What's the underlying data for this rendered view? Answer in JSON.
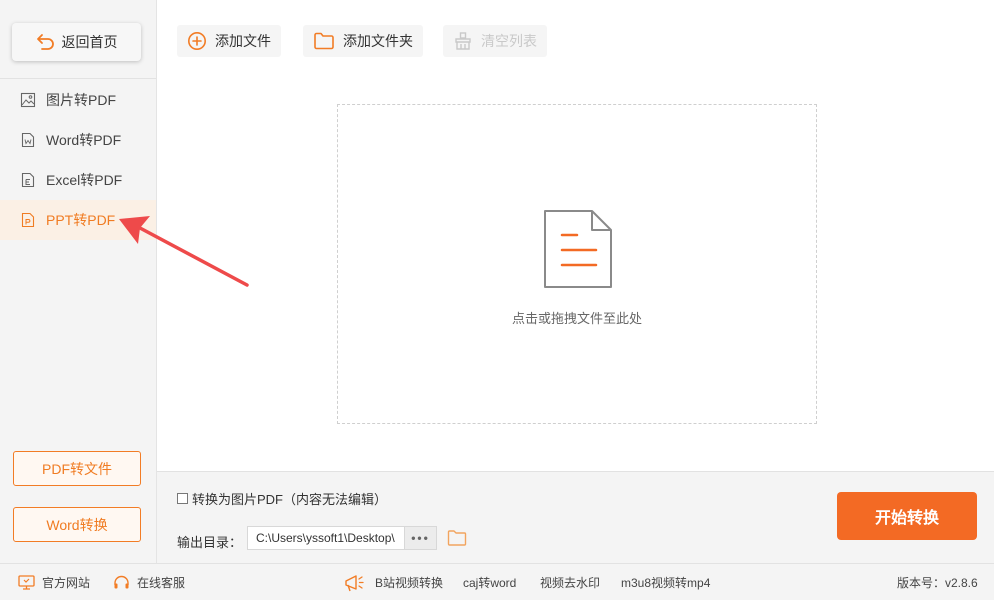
{
  "sidebar": {
    "back_label": "返回首页",
    "items": [
      {
        "label": "图片转PDF",
        "icon": "image-file-icon",
        "active": false
      },
      {
        "label": "Word转PDF",
        "icon": "word-file-icon",
        "active": false
      },
      {
        "label": "Excel转PDF",
        "icon": "excel-file-icon",
        "active": false
      },
      {
        "label": "PPT转PDF",
        "icon": "ppt-file-icon",
        "active": true
      }
    ],
    "bottom_buttons": [
      "PDF转文件",
      "Word转换"
    ]
  },
  "toolbar": {
    "add_file": "添加文件",
    "add_folder": "添加文件夹",
    "clear_list": "清空列表"
  },
  "dropzone": {
    "hint": "点击或拖拽文件至此处"
  },
  "options": {
    "image_pdf_label": "转换为图片PDF（内容无法编辑）",
    "image_pdf_checked": false,
    "output_label": "输出目录：",
    "output_path": "C:\\Users\\yssoft1\\Desktop\\",
    "browse_dots": "•••",
    "start_label": "开始转换"
  },
  "statusbar": {
    "website": "官方网站",
    "support": "在线客服",
    "links": [
      "B站视频转换",
      "caj转word",
      "视频去水印",
      "m3u8视频转mp4"
    ],
    "version": "版本号：v2.8.6"
  },
  "colors": {
    "accent": "#f36a24",
    "accent_text": "#f07c23",
    "active_bg": "#fbf0e5",
    "annotation_arrow": "#ee4a4a"
  }
}
